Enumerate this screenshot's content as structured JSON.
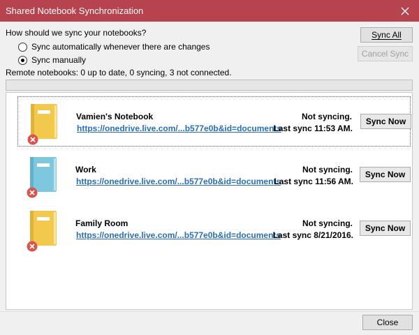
{
  "window": {
    "title": "Shared Notebook Synchronization",
    "accent": "#b6434e",
    "close_glyph": "✕"
  },
  "sync_options": {
    "question": "How should we sync your notebooks?",
    "options": [
      {
        "label": "Sync automatically whenever there are changes",
        "checked": false
      },
      {
        "label": "Sync manually",
        "checked": true
      }
    ]
  },
  "buttons": {
    "sync_all": "Sync All",
    "cancel_sync": "Cancel Sync",
    "close": "Close"
  },
  "remote_status": "Remote notebooks: 0 up to date, 0 syncing, 3 not connected.",
  "progress": {
    "value": 0
  },
  "notebooks": [
    {
      "name": "Vamien's Notebook",
      "link": "https://onedrive.live.com/...b577e0b&id=documents",
      "status": "Not syncing.",
      "last_sync": "Last sync 11:53 AM.",
      "sync_label": "Sync Now",
      "color": "#f2c94c",
      "spine": "#e0b23a",
      "icon": "notebook-icon",
      "error_icon": "error-x-icon",
      "selected": true
    },
    {
      "name": "Work",
      "link": "https://onedrive.live.com/...b577e0b&id=documents",
      "status": "Not syncing.",
      "last_sync": "Last sync 11:56 AM.",
      "sync_label": "Sync Now",
      "color": "#7ec8df",
      "spine": "#5fb3cd",
      "icon": "notebook-icon",
      "error_icon": "error-x-icon",
      "selected": false
    },
    {
      "name": "Family Room",
      "link": "https://onedrive.live.com/...b577e0b&id=documents",
      "status": "Not syncing.",
      "last_sync": "Last sync 8/21/2016.",
      "sync_label": "Sync Now",
      "color": "#f2c94c",
      "spine": "#e0b23a",
      "icon": "notebook-icon",
      "error_icon": "error-x-icon",
      "selected": false
    }
  ],
  "error_color": "#d9534f"
}
